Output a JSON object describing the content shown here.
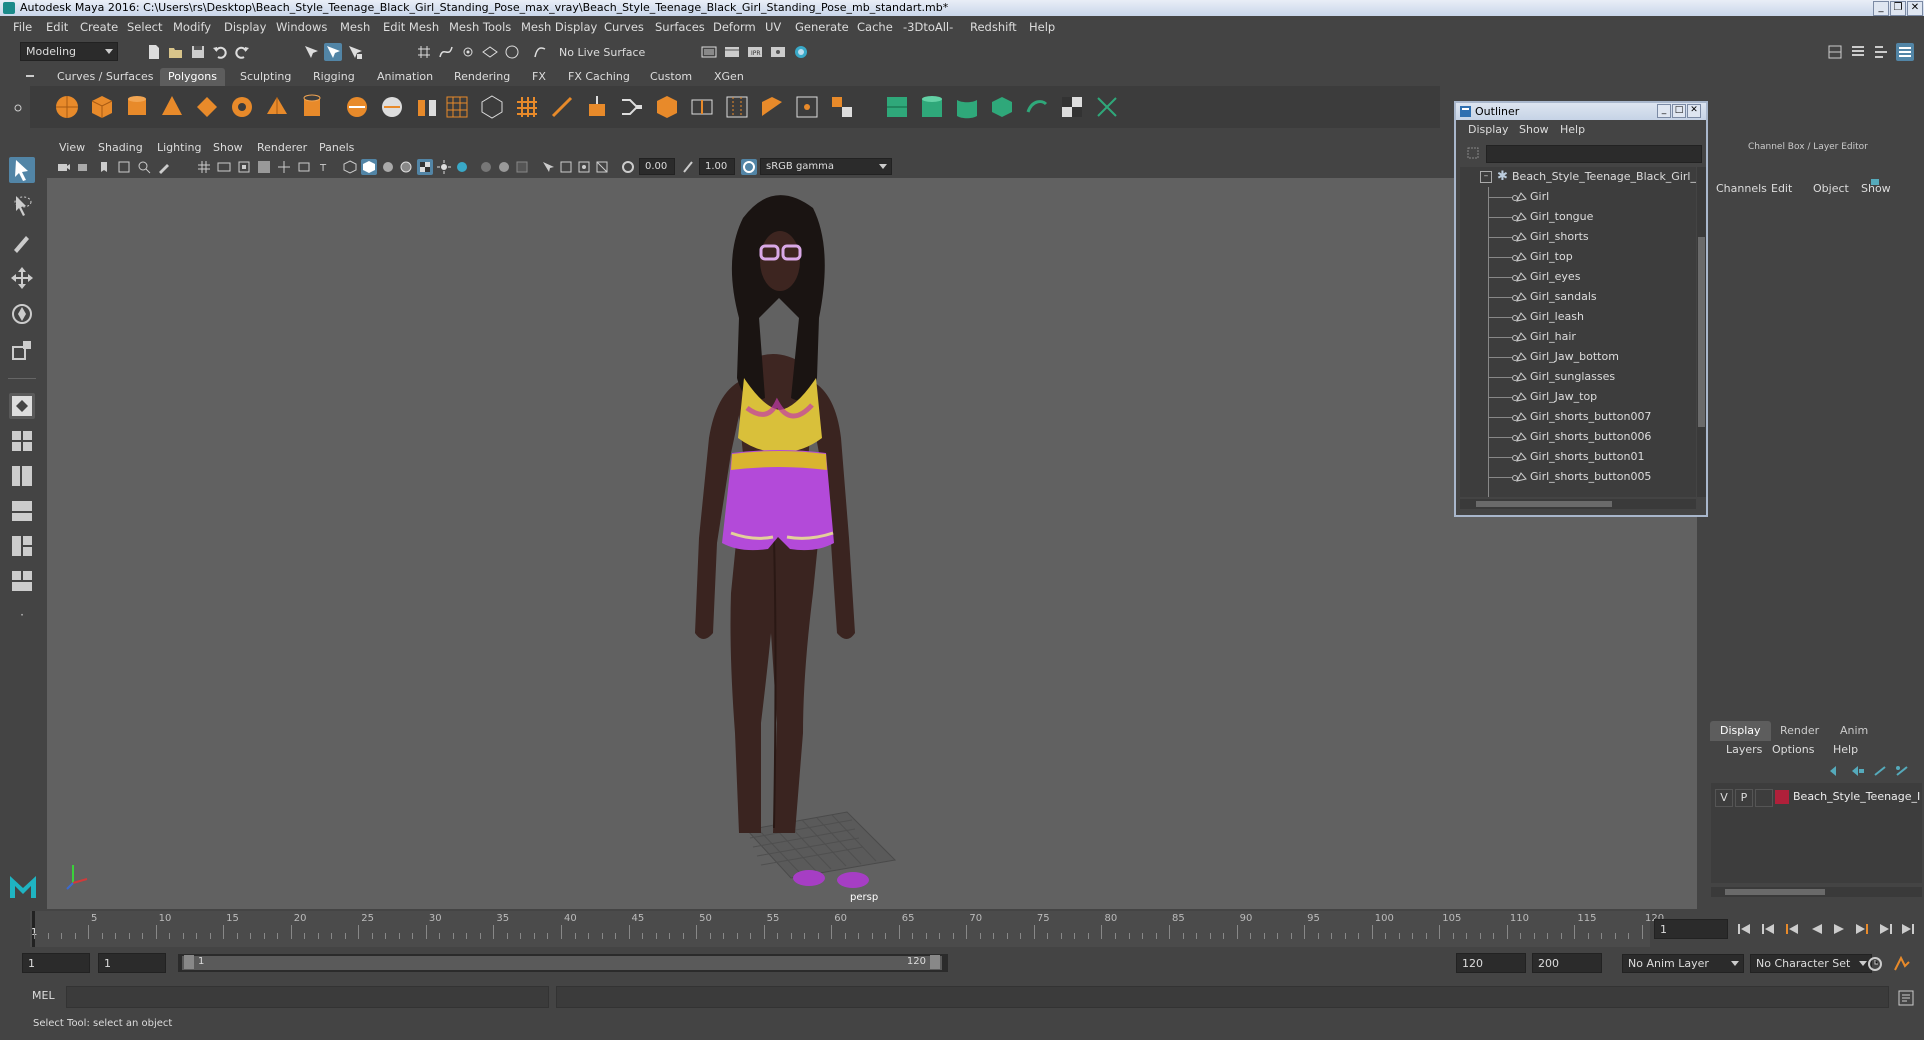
{
  "titlebar": {
    "title": "Autodesk Maya 2016: C:\\Users\\rs\\Desktop\\Beach_Style_Teenage_Black_Girl_Standing_Pose_max_vray\\Beach_Style_Teenage_Black_Girl_Standing_Pose_mb_standart.mb*",
    "minimize": "_",
    "restore": "❐",
    "close": "✕"
  },
  "menubar": [
    "File",
    "Edit",
    "Create",
    "Select",
    "Modify",
    "Display",
    "Windows",
    "Mesh",
    "Edit Mesh",
    "Mesh Tools",
    "Mesh Display",
    "Curves",
    "Surfaces",
    "Deform",
    "UV",
    "Generate",
    "Cache",
    "-3DtoAll-",
    "Redshift",
    "Help"
  ],
  "statusline": {
    "mode": "Modeling",
    "live_surface": "No Live Surface"
  },
  "shelf_tabs": [
    "Curves / Surfaces",
    "Polygons",
    "Sculpting",
    "Rigging",
    "Animation",
    "Rendering",
    "FX",
    "FX Caching",
    "Custom",
    "XGen"
  ],
  "shelf_active": "Polygons",
  "viewport": {
    "menu": [
      "View",
      "Shading",
      "Lighting",
      "Show",
      "Renderer",
      "Panels"
    ],
    "exposure": "0.00",
    "gamma": "1.00",
    "color_space": "sRGB gamma",
    "camera_label": "persp"
  },
  "outliner": {
    "title": "Outliner",
    "menu": [
      "Display",
      "Show",
      "Help"
    ],
    "root": "Beach_Style_Teenage_Black_Girl_S",
    "items": [
      "Girl",
      "Girl_tongue",
      "Girl_shorts",
      "Girl_top",
      "Girl_eyes",
      "Girl_sandals",
      "Girl_leash",
      "Girl_hair",
      "Girl_Jaw_bottom",
      "Girl_sunglasses",
      "Girl_Jaw_top",
      "Girl_shorts_button007",
      "Girl_shorts_button006",
      "Girl_shorts_button01",
      "Girl_shorts_button005"
    ]
  },
  "channelbox": {
    "header": "Channel Box / Layer Editor",
    "menu": [
      "Channels",
      "Edit",
      "Object",
      "Show"
    ],
    "layer_tabs": [
      "Display",
      "Render",
      "Anim"
    ],
    "layer_menu": [
      "Layers",
      "Options",
      "Help"
    ],
    "layer": {
      "v": "V",
      "p": "P",
      "name": "Beach_Style_Teenage_I",
      "color": "#b0203a"
    }
  },
  "timeline": {
    "ticks": [
      "5",
      "10",
      "15",
      "20",
      "25",
      "30",
      "35",
      "40",
      "45",
      "50",
      "55",
      "60",
      "65",
      "70",
      "75",
      "80",
      "85",
      "90",
      "95",
      "100",
      "105",
      "110",
      "115",
      "120"
    ],
    "start_marker": "1",
    "current_frame": "1"
  },
  "range": {
    "start": "1",
    "playback_start": "1",
    "slider_start": "1",
    "slider_end": "120",
    "playback_end": "120",
    "end": "200",
    "anim_layer": "No Anim Layer",
    "char_set": "No Character Set"
  },
  "cmdline": {
    "lang": "MEL"
  },
  "helpline": {
    "text": "Select Tool: select an object"
  },
  "colors": {
    "accent": "#5285a6",
    "bg": "#444444",
    "viewport": "#616161",
    "layer_red": "#b0203a"
  }
}
